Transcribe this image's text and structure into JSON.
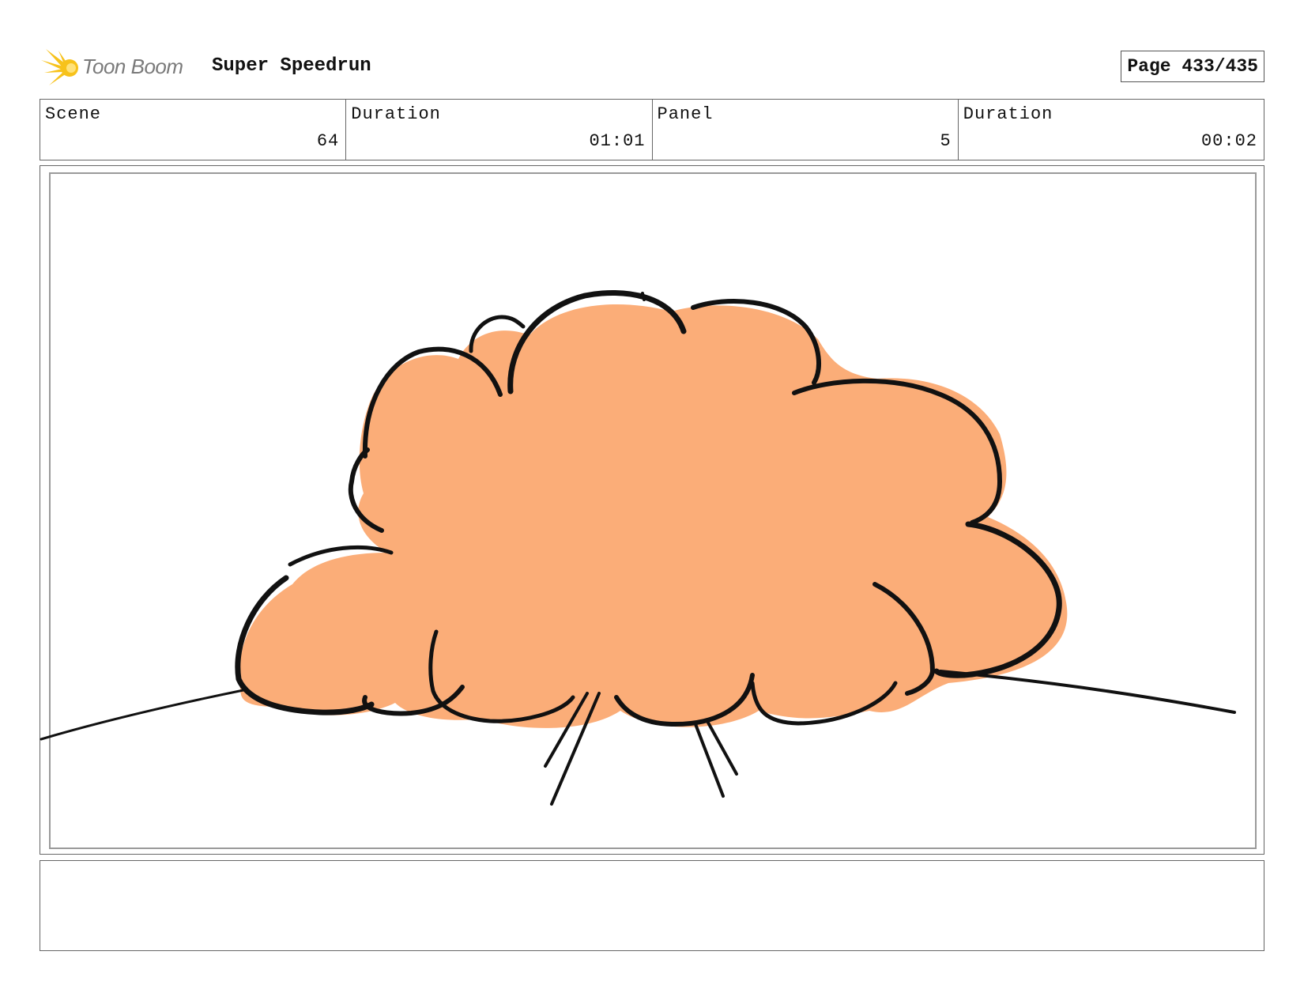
{
  "header": {
    "brand": "Toon Boom",
    "project_title": "Super Speedrun",
    "page_label": "Page 433/435"
  },
  "info": [
    {
      "label": "Scene",
      "value": "64"
    },
    {
      "label": "Duration",
      "value": "01:01"
    },
    {
      "label": "Panel",
      "value": "5"
    },
    {
      "label": "Duration",
      "value": "00:02"
    }
  ],
  "colors": {
    "smoke_fill": "#fbad78",
    "ink": "#111111",
    "logo_yellow": "#f7c21b"
  },
  "notes": ""
}
